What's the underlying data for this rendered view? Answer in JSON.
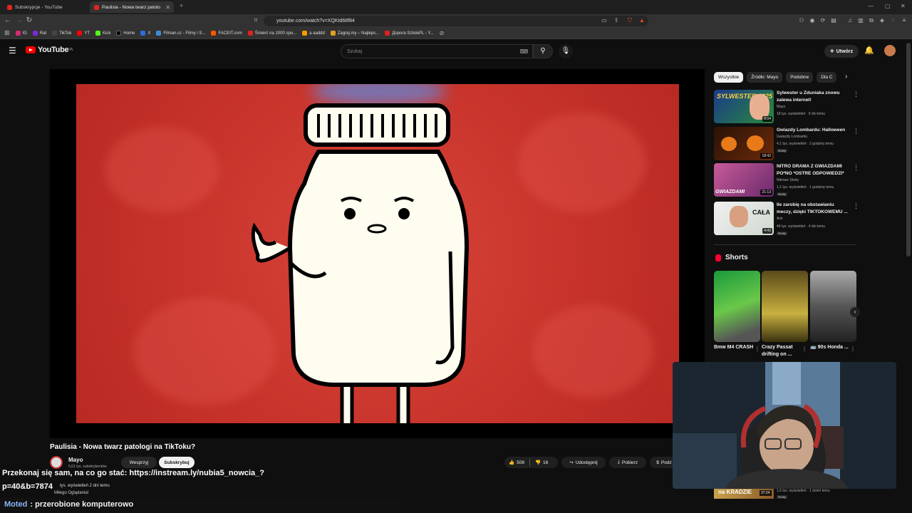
{
  "browser": {
    "tabs": [
      {
        "label": "Subskrypcje - YouTube",
        "active": false
      },
      {
        "label": "Paulisia - Nowa twarz patolo",
        "active": true
      }
    ],
    "url": "youtube.com/watch?v=XQKtd68f84",
    "bookmarks": [
      {
        "label": "IG",
        "color": "#d62976"
      },
      {
        "label": "Rat",
        "color": "#7a2ad6"
      },
      {
        "label": "TikTok",
        "color": "#111111"
      },
      {
        "label": "YT",
        "color": "#ff0000"
      },
      {
        "label": "Kick",
        "color": "#53fc18"
      },
      {
        "label": "Home",
        "color": "#000000"
      },
      {
        "label": "X",
        "color": "#2a6fd6"
      },
      {
        "label": "Filman.cc - Filmy i S...",
        "color": "#3a8dd6"
      },
      {
        "label": "FACEIT.com",
        "color": "#ff5500"
      },
      {
        "label": "Śmierć na 1000 spo...",
        "color": "#e02020"
      },
      {
        "label": "a aaddd",
        "color": "#ff9900"
      },
      {
        "label": "Zagraj.my – Najleps...",
        "color": "#e0a020"
      },
      {
        "label": "Доpora SztolePL - Y...",
        "color": "#e02020"
      }
    ]
  },
  "header": {
    "logo_text": "YouTube",
    "logo_region": "PL",
    "search_placeholder": "Szukaj",
    "create_label": "Utwórz"
  },
  "video": {
    "title": "Paulisia - Nowa twarz patologi na TikToku?",
    "channel": "Mayo",
    "subscribers": "5,61 tys. subskrybentów",
    "join_label": "Wesprzyj",
    "subscribe_label": "Subskrybuj",
    "likes": "508",
    "dislikes": "16",
    "share_label": "Udostępnij",
    "download_label": "Pobierz",
    "thanks_label": "Podz"
  },
  "description_overlay": {
    "line1": "Przekonaj się sam, na co go stać: https://instream.ly/nubia5_nowcia_?",
    "line2": "p=40&b=7874",
    "views": "tys. wyświetleń  2 dni temu",
    "note": "Miłego Oglądania!"
  },
  "moderator_line": {
    "user": "Moted",
    "text": ": przerobione komputerowo"
  },
  "sidebar": {
    "chips": [
      "Wszystkie",
      "Źródło: Mayo",
      "Podobne",
      "Dla C"
    ],
    "recommendations": [
      {
        "title": "Sylwester u Zduniaka znowu zalewa internet!",
        "channel": "Mayo",
        "views": "18 tys. wyświetleń · 9 dni temu",
        "duration": "8:04",
        "badge": "",
        "thumb_text": "SYLWESTER 2025",
        "thumb_color": "#1a3a8a"
      },
      {
        "title": "Gwiazdy Lombardu: Halloween",
        "channel": "Gwiazdy Lombardu",
        "views": "4,1 tys. wyświetleń · 2 godziny temu",
        "duration": "18:42",
        "badge": "Nowy",
        "thumb_text": "",
        "thumb_color": "#3a1a0a"
      },
      {
        "title": "NITRO DRAMA Z GWIAZDAMI PO*NO *OSTRE ODPOWIEDZI*",
        "channel": "Nitrowe Shoty",
        "views": "1,1 tys. wyświetleń · 1 godzinę temu",
        "duration": "21:13",
        "badge": "Nowy",
        "thumb_text": "GWIAZDAMI",
        "thumb_color": "#8a2a6a"
      },
      {
        "title": "Ile zarobię na obstawianiu meczy, dzięki TIKTOKOWEMU ...",
        "channel": "Avir",
        "views": "44 tys. wyświetleń · 4 dni temu",
        "duration": "4:43",
        "badge": "Nowy",
        "thumb_text": "CAŁA",
        "thumb_color": "#e8e8e8"
      }
    ],
    "shorts_title": "Shorts",
    "shorts": [
      {
        "title": "Bmw M4 CRASH",
        "color": "#3aa84a"
      },
      {
        "title": "Crazy Passat drifting on ...",
        "color": "#8a7a2a"
      },
      {
        "title": "🚌 90s Honda ...",
        "color": "#4a4a4a"
      }
    ],
    "bottom_rec": {
      "thumb_text": "na KRADZIE",
      "duration": "37:24",
      "views": "1,6 tys. wyświetleń · 1 dzień temu",
      "badge": "Nowy"
    }
  }
}
